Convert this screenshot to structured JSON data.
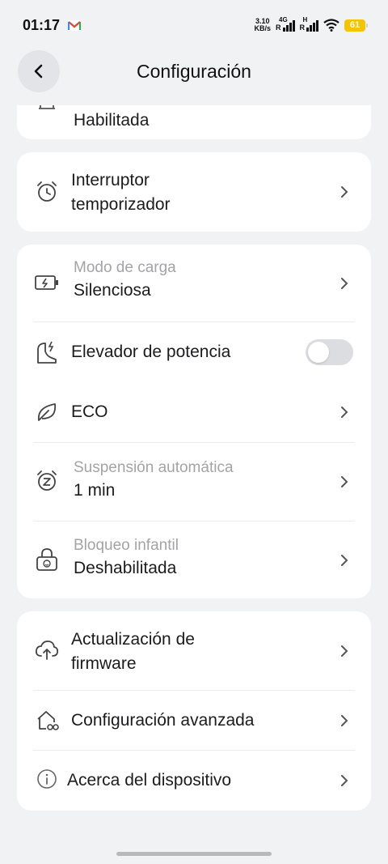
{
  "status_bar": {
    "time": "01:17",
    "net_speed_value": "3.10",
    "net_speed_unit": "KB/s",
    "sim1_label": "4G",
    "sim2_label": "H",
    "sim_r": "R",
    "battery": "61"
  },
  "header": {
    "title": "Configuración"
  },
  "card0": {
    "value": "Habilitada"
  },
  "card1": {
    "timer_label_line1": "Interruptor",
    "timer_label_line2": "temporizador"
  },
  "card2": {
    "charge_mode_title": "Modo de carga",
    "charge_mode_value": "Silenciosa",
    "power_boost_label": "Elevador de potencia",
    "power_boost_on": false,
    "eco_label": "ECO",
    "auto_sleep_title": "Suspensión automática",
    "auto_sleep_value": "1 min",
    "child_lock_title": "Bloqueo infantil",
    "child_lock_value": "Deshabilitada"
  },
  "card3": {
    "firmware_line1": "Actualización de",
    "firmware_line2": "firmware",
    "advanced_label": "Configuración avanzada",
    "about_label": "Acerca del dispositivo"
  },
  "colors": {
    "background": "#f1f2f4",
    "card": "#ffffff",
    "text_primary": "#1c1c1e",
    "text_secondary": "#a3a3a8",
    "battery": "#f5c400",
    "toggle_off": "#dcdde0"
  },
  "icons": [
    "gmail-icon",
    "wifi-icon",
    "back-arrow-icon",
    "alarm-clock-icon",
    "battery-charge-icon",
    "power-boost-icon",
    "leaf-icon",
    "sleep-clock-icon",
    "lock-icon",
    "cloud-upload-icon",
    "advanced-settings-icon",
    "info-icon",
    "chevron-right-icon"
  ]
}
